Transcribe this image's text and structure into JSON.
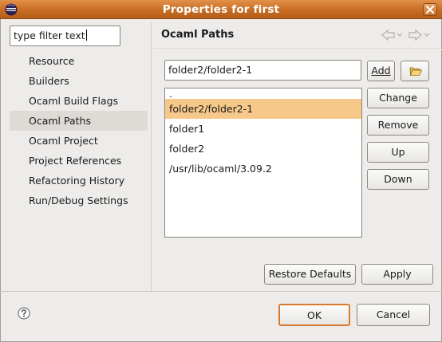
{
  "window": {
    "title": "Properties for first"
  },
  "filter": {
    "value": "type filter text"
  },
  "nav": {
    "items": [
      {
        "label": "Resource",
        "selected": false
      },
      {
        "label": "Builders",
        "selected": false
      },
      {
        "label": "Ocaml Build Flags",
        "selected": false
      },
      {
        "label": "Ocaml Paths",
        "selected": true
      },
      {
        "label": "Ocaml Project",
        "selected": false
      },
      {
        "label": "Project References",
        "selected": false
      },
      {
        "label": "Refactoring History",
        "selected": false
      },
      {
        "label": "Run/Debug Settings",
        "selected": false
      }
    ]
  },
  "page": {
    "title": "Ocaml Paths",
    "path_input_value": "folder2/folder2-1",
    "add_label": "Add",
    "paths": [
      {
        "label": ".",
        "selected": false
      },
      {
        "label": "folder2/folder2-1",
        "selected": true
      },
      {
        "label": "folder1",
        "selected": false
      },
      {
        "label": "folder2",
        "selected": false
      },
      {
        "label": "/usr/lib/ocaml/3.09.2",
        "selected": false
      }
    ],
    "change_label": "Change",
    "remove_label": "Remove",
    "up_label": "Up",
    "down_label": "Down",
    "restore_label": "Restore Defaults",
    "apply_label": "Apply"
  },
  "footer": {
    "ok_label": "OK",
    "cancel_label": "Cancel"
  },
  "colors": {
    "titlebar": "#c86c22",
    "selection_list": "#f6c889",
    "selection_nav": "#dedad5",
    "default_button_border": "#d97a2c"
  },
  "icons": {
    "titlebar": "eclipse-icon",
    "close": "close-icon",
    "back": "back-arrow-icon",
    "forward": "forward-arrow-icon",
    "browse": "folder-open-icon",
    "help": "help-icon"
  }
}
